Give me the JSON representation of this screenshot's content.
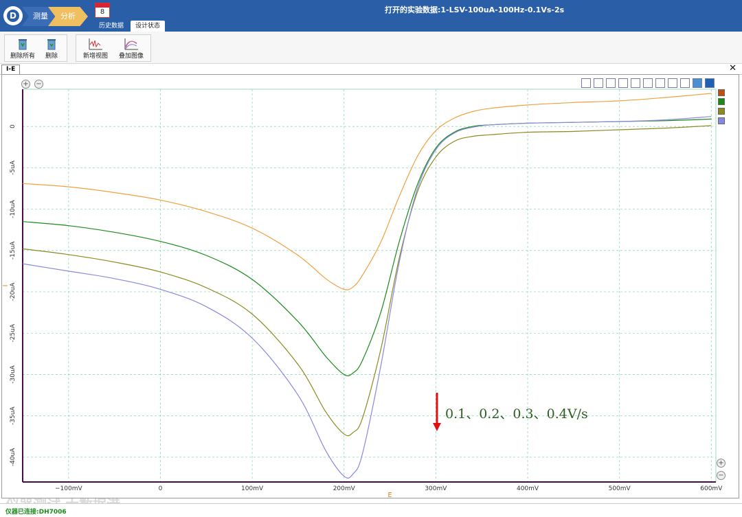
{
  "app": {
    "window_title": "打开的实验数据:1-LSV-100uA-100Hz-0.1Vs-2s",
    "logo_letter": "D",
    "steps": [
      {
        "label": "测量"
      },
      {
        "label": "分析"
      }
    ],
    "calendar_day": "8",
    "tabs": [
      {
        "label": "历史数据"
      },
      {
        "label": "设计状态"
      }
    ]
  },
  "toolbar": {
    "groups": [
      [
        {
          "label": "删除所有",
          "icon": "trash-all-icon"
        },
        {
          "label": "删除",
          "icon": "trash-icon"
        }
      ],
      [
        {
          "label": "新增视图",
          "icon": "new-view-icon"
        },
        {
          "label": "叠加图像",
          "icon": "overlay-icon"
        }
      ]
    ]
  },
  "document": {
    "tab_label": "I-E",
    "close_label": "✕"
  },
  "status": {
    "text": "仪器已连接:DH7006"
  },
  "watermark": "仪器测试 大数据港",
  "annotation": {
    "arrow_color": "#e01010",
    "text": "0.1、0.2、0.3、0.4V/s"
  },
  "chart_data": {
    "type": "line",
    "xlabel": "E",
    "ylabel": "I",
    "x_unit": "mV",
    "y_unit": "uA",
    "xlim": [
      -150,
      605
    ],
    "ylim": [
      -43,
      4.5
    ],
    "x_ticks": [
      -100,
      0,
      100,
      200,
      300,
      400,
      500,
      600
    ],
    "x_tick_labels": [
      "−100mV",
      "0",
      "100mV",
      "200mV",
      "300mV",
      "400mV",
      "500mV",
      "600mV"
    ],
    "y_ticks": [
      0,
      -5,
      -10,
      -15,
      -20,
      -25,
      -30,
      -35,
      -40
    ],
    "y_tick_labels": [
      "0",
      "-5uA",
      "-10uA",
      "-15uA",
      "-20uA",
      "-25uA",
      "-30uA",
      "-35uA",
      "-40uA"
    ],
    "grid": true,
    "series": [
      {
        "color": "#f0a040",
        "x": [
          -150,
          -100,
          -50,
          0,
          50,
          100,
          150,
          180,
          200,
          210,
          220,
          240,
          260,
          280,
          300,
          320,
          340,
          360,
          400,
          450,
          500,
          550,
          600
        ],
        "y": [
          -6.9,
          -7.3,
          -8.0,
          -8.9,
          -10.3,
          -12.3,
          -15.6,
          -18.4,
          -19.7,
          -19.4,
          -18.0,
          -14.0,
          -8.5,
          -3.6,
          -0.5,
          1.0,
          1.8,
          2.2,
          2.6,
          2.9,
          3.1,
          3.5,
          4.0
        ]
      },
      {
        "color": "#1a8a1a",
        "x": [
          -150,
          -100,
          -50,
          0,
          50,
          100,
          150,
          180,
          200,
          210,
          220,
          240,
          260,
          280,
          300,
          320,
          340,
          360,
          400,
          450,
          500,
          550,
          600
        ],
        "y": [
          -11.5,
          -12.0,
          -12.8,
          -13.9,
          -15.6,
          -18.5,
          -23.6,
          -27.8,
          -30.0,
          -29.8,
          -28.3,
          -22.5,
          -14.0,
          -7.0,
          -2.6,
          -0.7,
          0.0,
          0.2,
          0.4,
          0.5,
          0.6,
          0.7,
          0.9
        ]
      },
      {
        "color": "#8a8a20",
        "x": [
          -150,
          -100,
          -50,
          0,
          50,
          100,
          150,
          180,
          200,
          210,
          220,
          240,
          260,
          280,
          300,
          320,
          340,
          360,
          400,
          450,
          500,
          550,
          600
        ],
        "y": [
          -14.8,
          -15.5,
          -16.4,
          -17.6,
          -19.5,
          -22.7,
          -28.8,
          -34.5,
          -37.2,
          -37.0,
          -35.3,
          -27.0,
          -16.0,
          -7.9,
          -3.7,
          -1.8,
          -1.2,
          -1.0,
          -0.7,
          -0.6,
          -0.4,
          -0.2,
          0.1
        ]
      },
      {
        "color": "#8888e0",
        "x": [
          -150,
          -100,
          -50,
          0,
          50,
          100,
          150,
          180,
          200,
          210,
          220,
          240,
          260,
          280,
          300,
          320,
          340,
          360,
          400,
          450,
          500,
          550,
          600
        ],
        "y": [
          -16.6,
          -17.5,
          -18.4,
          -19.7,
          -21.8,
          -25.6,
          -32.5,
          -39.2,
          -42.3,
          -42.0,
          -39.6,
          -29.0,
          -16.5,
          -7.5,
          -2.8,
          -0.8,
          -0.1,
          0.2,
          0.4,
          0.5,
          0.6,
          0.8,
          1.2
        ]
      }
    ],
    "legend_colors": [
      "#c05010",
      "#1a8a1a",
      "#8a8a20",
      "#8888e0"
    ]
  }
}
